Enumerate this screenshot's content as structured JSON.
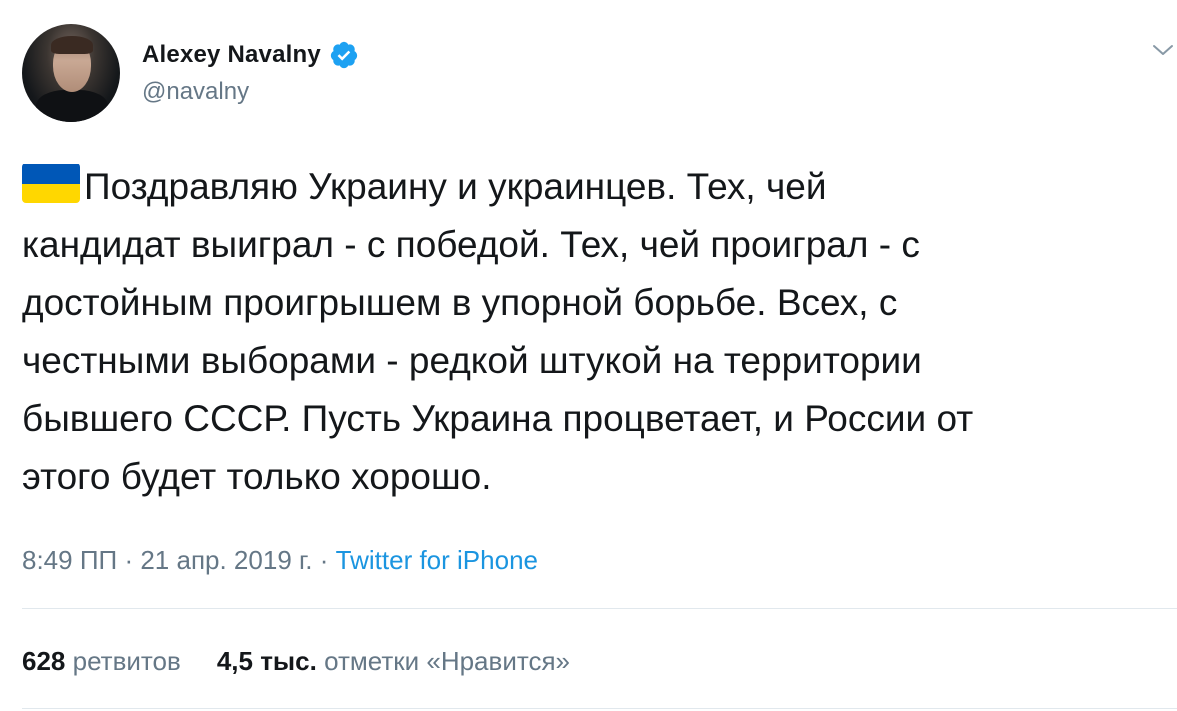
{
  "author": {
    "display_name": "Alexey Navalny",
    "handle": "@navalny",
    "verified": true,
    "avatar": "profile-photo"
  },
  "tweet": {
    "flag_icon": "ukraine-flag-emoji",
    "lines": [
      "Поздравляю Украину и украинцев. Тех, чей",
      "кандидат выиграл - с победой. Тех, чей проиграл - с",
      "достойным проигрышем в упорной борьбе. Всех, с",
      "честными выборами - редкой штукой на территории",
      "бывшего СССР. Пусть Украина процветает, и России от",
      "этого будет только хорошо."
    ]
  },
  "meta": {
    "time": "8:49 ПП",
    "date": "21 апр. 2019 г.",
    "separator": "·",
    "source": "Twitter for iPhone"
  },
  "stats": {
    "retweets_count": "628",
    "retweets_label": "ретвитов",
    "likes_count": "4,5 тыс.",
    "likes_label": "отметки «Нравится»"
  },
  "colors": {
    "text": "#14171a",
    "secondary": "#657786",
    "link": "#1b95e0",
    "verified": "#1da1f2",
    "divider": "#e1e8ed",
    "flag_blue": "#0057b7",
    "flag_yellow": "#ffd700"
  },
  "icons": {
    "verified": "verified-badge-icon",
    "caret": "chevron-down-icon"
  }
}
